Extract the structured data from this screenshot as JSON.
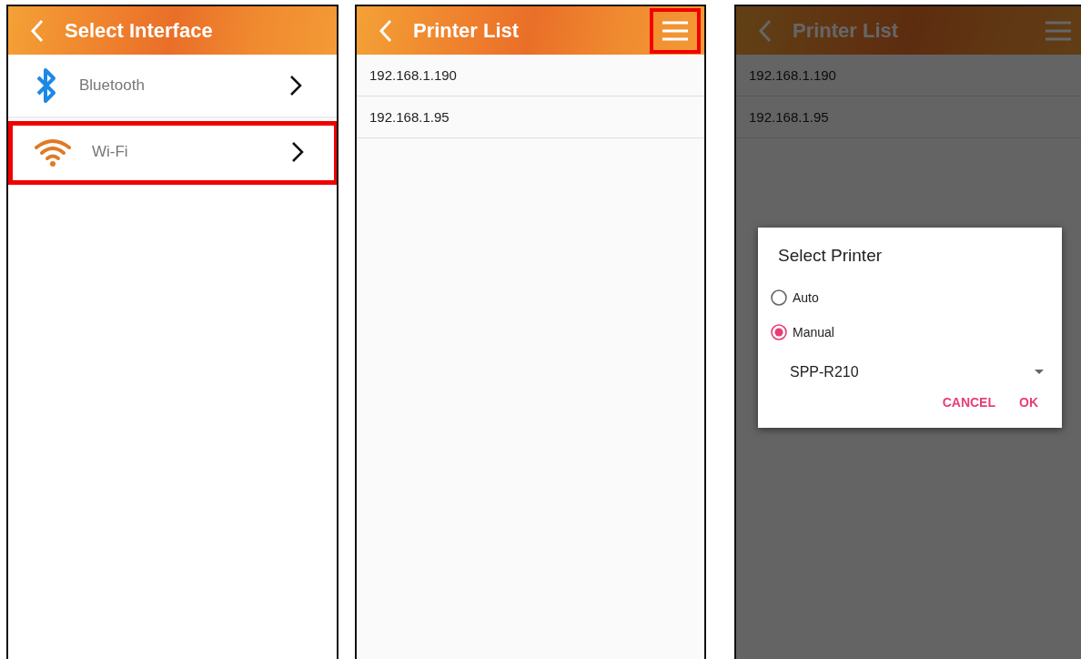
{
  "screens": [
    {
      "kind": "interface_list",
      "title": "Select Interface",
      "items": [
        {
          "kind": "bluetooth",
          "label": "Bluetooth",
          "highlighted": false
        },
        {
          "kind": "wifi",
          "label": "Wi-Fi",
          "highlighted": true
        }
      ]
    },
    {
      "kind": "printer_list",
      "title": "Printer List",
      "menu_button": {
        "highlighted": true
      },
      "items": [
        {
          "label": "192.168.1.190"
        },
        {
          "label": "192.168.1.95"
        }
      ]
    },
    {
      "kind": "printer_list",
      "title": "Printer List",
      "menu_button": {
        "highlighted": false
      },
      "items": [
        {
          "label": "192.168.1.190"
        },
        {
          "label": "192.168.1.95"
        }
      ],
      "dialog": {
        "title": "Select Printer",
        "options": [
          {
            "label": "Auto",
            "selected": false
          },
          {
            "label": "Manual",
            "selected": true
          }
        ],
        "dropdown": {
          "value": "SPP-R210"
        },
        "buttons": [
          "CANCEL",
          "OK"
        ]
      }
    }
  ]
}
